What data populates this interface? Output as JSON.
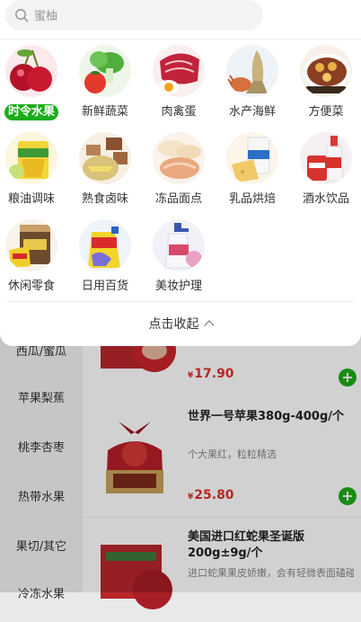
{
  "search": {
    "placeholder": "蜜柚"
  },
  "categories": [
    {
      "label": "时令水果",
      "active": true
    },
    {
      "label": "新鲜蔬菜"
    },
    {
      "label": "肉禽蛋"
    },
    {
      "label": "水产海鲜"
    },
    {
      "label": "方便菜"
    },
    {
      "label": "粮油调味"
    },
    {
      "label": "熟食卤味"
    },
    {
      "label": "冻品面点"
    },
    {
      "label": "乳品烘焙"
    },
    {
      "label": "酒水饮品"
    },
    {
      "label": "休闲零食"
    },
    {
      "label": "日用百货"
    },
    {
      "label": "美妆护理"
    }
  ],
  "collapse_label": "点击收起",
  "sidebar": {
    "items": [
      "西瓜/蜜瓜",
      "苹果梨蕉",
      "桃李杏枣",
      "热带水果",
      "果切/其它",
      "冷冻水果"
    ]
  },
  "products": [
    {
      "title": "",
      "desc": "",
      "currency": "¥",
      "price": "17.90"
    },
    {
      "title": "世界一号苹果380g-400g/个",
      "desc": "个大果红，粒粒精选",
      "currency": "¥",
      "price": "25.80"
    },
    {
      "title": "美国进口红蛇果圣诞版200g±9g/个",
      "desc": "进口蛇果果皮娇嫩，会有轻微表面磕碰",
      "currency": "¥",
      "price": ""
    }
  ],
  "colors": {
    "accent": "#1aad19",
    "price": "#e0312b"
  }
}
